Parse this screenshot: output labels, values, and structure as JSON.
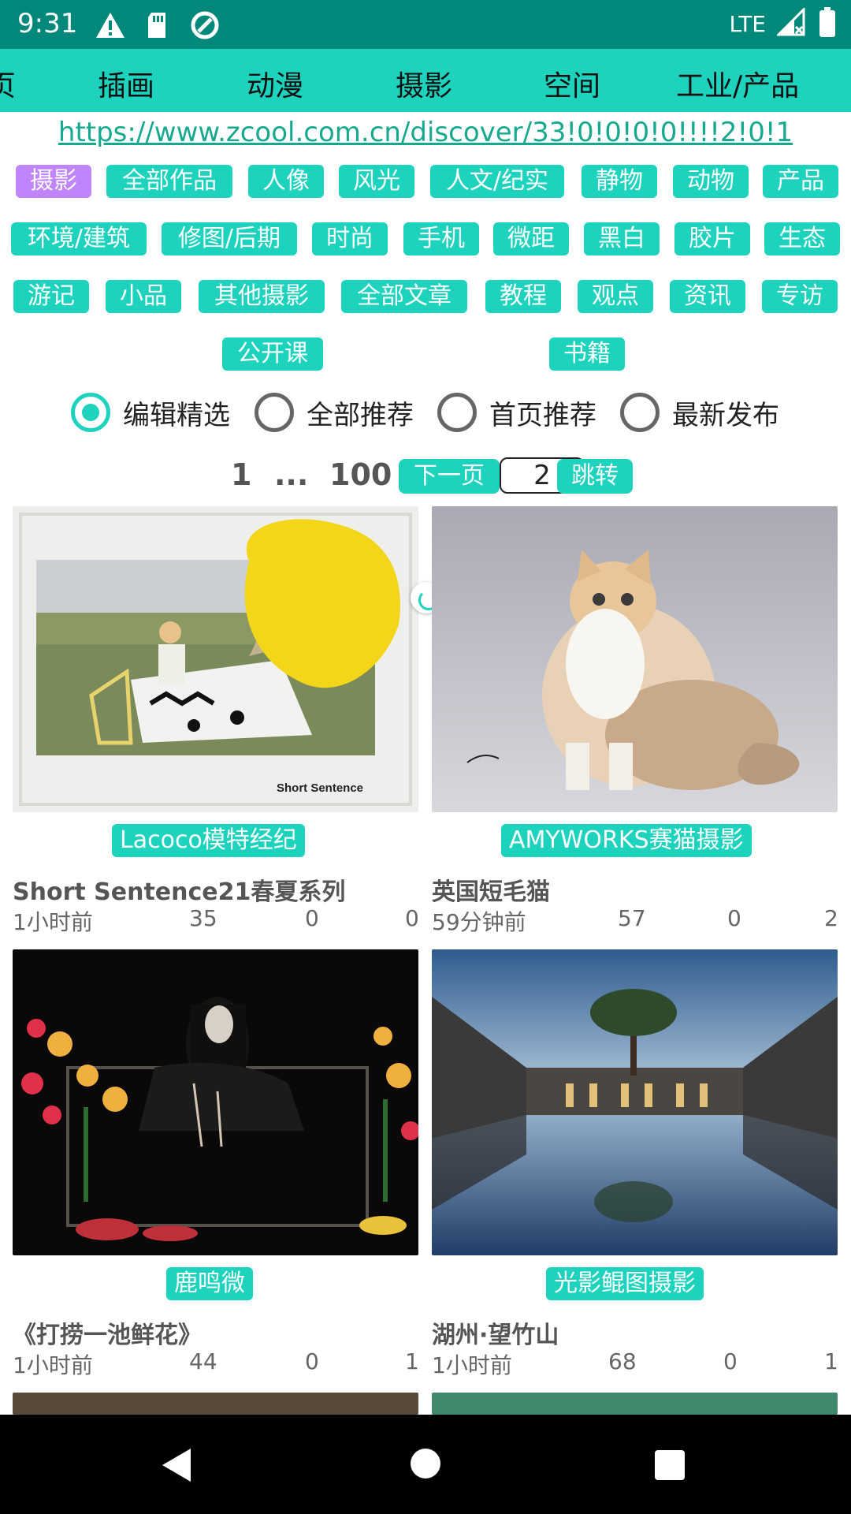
{
  "status_bar": {
    "time": "9:31",
    "network": "LTE"
  },
  "category_tabs": [
    "页",
    "插画",
    "动漫",
    "摄影",
    "空间",
    "工业/产品"
  ],
  "url": "https://www.zcool.com.cn/discover/33!0!0!0!0!!!!2!0!1",
  "subcategories": {
    "row1": [
      "摄影",
      "全部作品",
      "人像",
      "风光",
      "人文/纪实",
      "静物",
      "动物",
      "产品"
    ],
    "row2": [
      "环境/建筑",
      "修图/后期",
      "时尚",
      "手机",
      "微距",
      "黑白",
      "胶片",
      "生态"
    ],
    "row3": [
      "游记",
      "小品",
      "其他摄影",
      "全部文章",
      "教程",
      "观点",
      "资讯",
      "专访"
    ],
    "row4": [
      "公开课",
      "书籍"
    ],
    "active": "摄影"
  },
  "sort_options": [
    "编辑精选",
    "全部推荐",
    "首页推荐",
    "最新发布"
  ],
  "sort_selected": "编辑精选",
  "pagination": {
    "first": "1",
    "ellipsis": "...",
    "last": "100",
    "next_label": "下一页",
    "page_input": "2",
    "jump_label": "跳转"
  },
  "cards": [
    {
      "author": "Lacoco模特经纪",
      "title": "Short Sentence21春夏系列",
      "time": "1小时前",
      "views": "35",
      "comments": "0",
      "likes": "0",
      "image_caption": "Short Sentence"
    },
    {
      "author": "AMYWORKS赛猫摄影",
      "title": "英国短毛猫",
      "time": "59分钟前",
      "views": "57",
      "comments": "0",
      "likes": "2"
    },
    {
      "author": "鹿鸣微",
      "title": "《打捞一池鲜花》",
      "time": "1小时前",
      "views": "44",
      "comments": "0",
      "likes": "1"
    },
    {
      "author": "光影鲲图摄影",
      "title": "湖州·望竹山",
      "time": "1小时前",
      "views": "68",
      "comments": "0",
      "likes": "1"
    }
  ],
  "colors": {
    "status_bar": "#00897b",
    "accent": "#1dd3bd",
    "active_chip": "#c084fc",
    "link": "#16a98e"
  }
}
